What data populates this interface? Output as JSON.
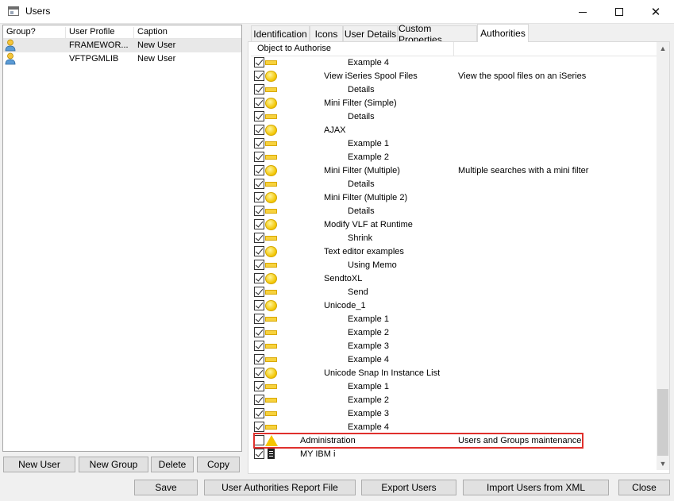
{
  "window": {
    "title": "Users"
  },
  "users_list": {
    "columns": [
      "Group?",
      "User Profile",
      "Caption"
    ],
    "rows": [
      {
        "profile": "FRAMEWOR...",
        "caption": "New User",
        "selected": true
      },
      {
        "profile": "VFTPGMLIB",
        "caption": "New User",
        "selected": false
      }
    ]
  },
  "left_buttons": {
    "new_user": "New User",
    "new_group": "New Group",
    "delete": "Delete",
    "copy": "Copy"
  },
  "tabs": [
    "Identification",
    "Icons",
    "User Details",
    "Custom Properties",
    "Authorities"
  ],
  "authorities": {
    "column_object": "Object to Authorise",
    "rows": [
      {
        "label": "Example 4",
        "caption": "",
        "icon": "bar-icon",
        "checked": true,
        "level": 2
      },
      {
        "label": "View iSeries Spool Files",
        "caption": "View the spool files on an iSeries",
        "icon": "circle-icon",
        "checked": true,
        "level": 1
      },
      {
        "label": "Details",
        "caption": "",
        "icon": "bar-icon",
        "checked": true,
        "level": 2
      },
      {
        "label": "Mini Filter (Simple)",
        "caption": "",
        "icon": "circle-icon",
        "checked": true,
        "level": 1
      },
      {
        "label": "Details",
        "caption": "",
        "icon": "bar-icon",
        "checked": true,
        "level": 2
      },
      {
        "label": "AJAX",
        "caption": "",
        "icon": "circle-icon",
        "checked": true,
        "level": 1
      },
      {
        "label": "Example 1",
        "caption": "",
        "icon": "bar-icon",
        "checked": true,
        "level": 2
      },
      {
        "label": "Example 2",
        "caption": "",
        "icon": "bar-icon",
        "checked": true,
        "level": 2
      },
      {
        "label": "Mini Filter (Multiple)",
        "caption": "Multiple searches with a mini filter",
        "icon": "circle-icon",
        "checked": true,
        "level": 1
      },
      {
        "label": "Details",
        "caption": "",
        "icon": "bar-icon",
        "checked": true,
        "level": 2
      },
      {
        "label": "Mini Filter (Multiple 2)",
        "caption": "",
        "icon": "circle-icon",
        "checked": true,
        "level": 1
      },
      {
        "label": "Details",
        "caption": "",
        "icon": "bar-icon",
        "checked": true,
        "level": 2
      },
      {
        "label": "Modify VLF at Runtime",
        "caption": "",
        "icon": "circle-icon",
        "checked": true,
        "level": 1
      },
      {
        "label": "Shrink",
        "caption": "",
        "icon": "bar-icon",
        "checked": true,
        "level": 2
      },
      {
        "label": "Text editor examples",
        "caption": "",
        "icon": "circle-icon",
        "checked": true,
        "level": 1
      },
      {
        "label": "Using Memo",
        "caption": "",
        "icon": "bar-icon",
        "checked": true,
        "level": 2
      },
      {
        "label": "SendtoXL",
        "caption": "",
        "icon": "circle-icon",
        "checked": true,
        "level": 1
      },
      {
        "label": "Send",
        "caption": "",
        "icon": "bar-icon",
        "checked": true,
        "level": 2
      },
      {
        "label": "Unicode_1",
        "caption": "",
        "icon": "circle-icon",
        "checked": true,
        "level": 1
      },
      {
        "label": "Example 1",
        "caption": "",
        "icon": "bar-icon",
        "checked": true,
        "level": 2
      },
      {
        "label": "Example 2",
        "caption": "",
        "icon": "bar-icon",
        "checked": true,
        "level": 2
      },
      {
        "label": "Example 3",
        "caption": "",
        "icon": "bar-icon",
        "checked": true,
        "level": 2
      },
      {
        "label": "Example 4",
        "caption": "",
        "icon": "bar-icon",
        "checked": true,
        "level": 2
      },
      {
        "label": "Unicode Snap In Instance List",
        "caption": "",
        "icon": "circle-icon",
        "checked": true,
        "level": 1
      },
      {
        "label": "Example 1",
        "caption": "",
        "icon": "bar-icon",
        "checked": true,
        "level": 2
      },
      {
        "label": "Example 2",
        "caption": "",
        "icon": "bar-icon",
        "checked": true,
        "level": 2
      },
      {
        "label": "Example 3",
        "caption": "",
        "icon": "bar-icon",
        "checked": true,
        "level": 2
      },
      {
        "label": "Example 4",
        "caption": "",
        "icon": "bar-icon",
        "checked": true,
        "level": 2
      },
      {
        "label": "Administration",
        "caption": "Users and Groups maintenance",
        "icon": "triangle-icon",
        "checked": false,
        "level": 0,
        "highlighted": true
      },
      {
        "label": "MY IBM i",
        "caption": "",
        "icon": "document-icon",
        "checked": true,
        "level": 0
      }
    ]
  },
  "bottom_buttons": {
    "save": "Save",
    "report": "User Authorities Report File",
    "export": "Export Users",
    "import": "Import Users from XML",
    "close": "Close"
  },
  "colors": {
    "highlight_border": "#e0302c",
    "selected_row": "#e8e8e8"
  }
}
